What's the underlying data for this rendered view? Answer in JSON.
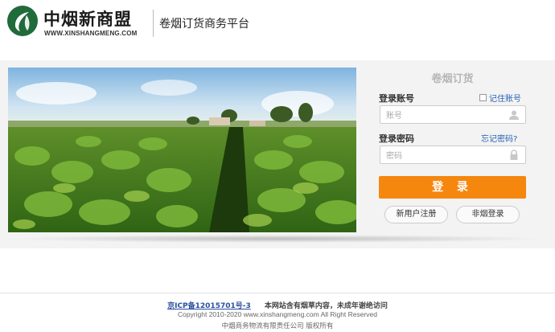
{
  "header": {
    "logo_title": "中烟新商盟",
    "logo_url": "WWW.XINSHANGMENG.COM",
    "platform_name": "卷烟订货商务平台"
  },
  "login": {
    "title": "卷烟订货",
    "account_label": "登录账号",
    "remember_label": "记住账号",
    "account_placeholder": "账号",
    "password_label": "登录密码",
    "forgot_label": "忘记密码?",
    "password_placeholder": "密码",
    "submit_label": "登 录",
    "register_label": "新用户注册",
    "non_tobacco_label": "非烟登录"
  },
  "footer": {
    "icp": "京ICP备12015701号-3",
    "notice": "本网站含有烟草内容，未成年谢绝访问",
    "copyright": "Copyright 2010-2020 www.xinshangmeng.com All Right Reserved",
    "company": "中烟商务物流有限责任公司 版权所有"
  },
  "colors": {
    "accent": "#f5870f",
    "link": "#2a62b5",
    "brand_green": "#1f6b3a"
  },
  "icons": {
    "logo": "tobacco-leaf-logo-icon",
    "user": "user-icon",
    "lock": "lock-icon"
  }
}
